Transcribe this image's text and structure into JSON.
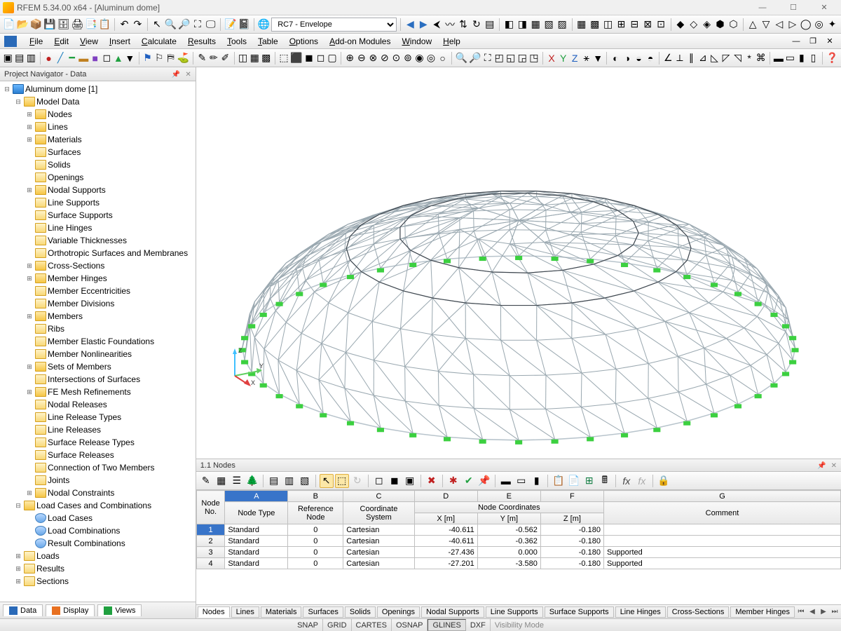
{
  "app": {
    "title": "RFEM 5.34.00 x64 - [Aluminum dome]"
  },
  "winbtns": {
    "min": "—",
    "max": "☐",
    "close": "✕"
  },
  "menubar": [
    "File",
    "Edit",
    "View",
    "Insert",
    "Calculate",
    "Results",
    "Tools",
    "Table",
    "Options",
    "Add-on Modules",
    "Window",
    "Help"
  ],
  "combo1": "RC7 - Envelope",
  "navigator": {
    "title": "Project Navigator - Data",
    "root": "Aluminum dome [1]",
    "modelData": "Model Data",
    "items": [
      "Nodes",
      "Lines",
      "Materials",
      "Surfaces",
      "Solids",
      "Openings",
      "Nodal Supports",
      "Line Supports",
      "Surface Supports",
      "Line Hinges",
      "Variable Thicknesses",
      "Orthotropic Surfaces and Membranes",
      "Cross-Sections",
      "Member Hinges",
      "Member Eccentricities",
      "Member Divisions",
      "Members",
      "Ribs",
      "Member Elastic Foundations",
      "Member Nonlinearities",
      "Sets of Members",
      "Intersections of Surfaces",
      "FE Mesh Refinements",
      "Nodal Releases",
      "Line Release Types",
      "Line Releases",
      "Surface Release Types",
      "Surface Releases",
      "Connection of Two Members",
      "Joints",
      "Nodal Constraints"
    ],
    "lccombos": "Load Cases and Combinations",
    "lcitems": [
      "Load Cases",
      "Load Combinations",
      "Result Combinations"
    ],
    "extra": [
      "Loads",
      "Results",
      "Sections"
    ],
    "tabs": [
      "Data",
      "Display",
      "Views"
    ]
  },
  "axes": {
    "x": "X",
    "y": "Y",
    "z": "Z"
  },
  "datapanel": {
    "title": "1.1 Nodes",
    "colLetters": [
      "A",
      "B",
      "C",
      "D",
      "E",
      "F",
      "G"
    ],
    "header1": {
      "node": "Node",
      "no": "No.",
      "coord": "Node Coordinates"
    },
    "header2": {
      "nodeType": "Node Type",
      "refNode": "Reference Node",
      "coordSys": "Coordinate System",
      "x": "X [m]",
      "y": "Y [m]",
      "z": "Z [m]",
      "comment": "Comment"
    },
    "rows": [
      {
        "n": "1",
        "type": "Standard",
        "ref": "0",
        "sys": "Cartesian",
        "x": "-40.611",
        "y": "-0.562",
        "z": "-0.180",
        "c": ""
      },
      {
        "n": "2",
        "type": "Standard",
        "ref": "0",
        "sys": "Cartesian",
        "x": "-40.611",
        "y": "-0.362",
        "z": "-0.180",
        "c": ""
      },
      {
        "n": "3",
        "type": "Standard",
        "ref": "0",
        "sys": "Cartesian",
        "x": "-27.436",
        "y": "0.000",
        "z": "-0.180",
        "c": "Supported"
      },
      {
        "n": "4",
        "type": "Standard",
        "ref": "0",
        "sys": "Cartesian",
        "x": "-27.201",
        "y": "-3.580",
        "z": "-0.180",
        "c": "Supported"
      }
    ],
    "tabs": [
      "Nodes",
      "Lines",
      "Materials",
      "Surfaces",
      "Solids",
      "Openings",
      "Nodal Supports",
      "Line Supports",
      "Surface Supports",
      "Line Hinges",
      "Cross-Sections",
      "Member Hinges"
    ]
  },
  "statusbar": {
    "snap": "SNAP",
    "grid": "GRID",
    "cartes": "CARTES",
    "osnap": "OSNAP",
    "glines": "GLINES",
    "dxf": "DXF",
    "vis": "Visibility Mode"
  }
}
